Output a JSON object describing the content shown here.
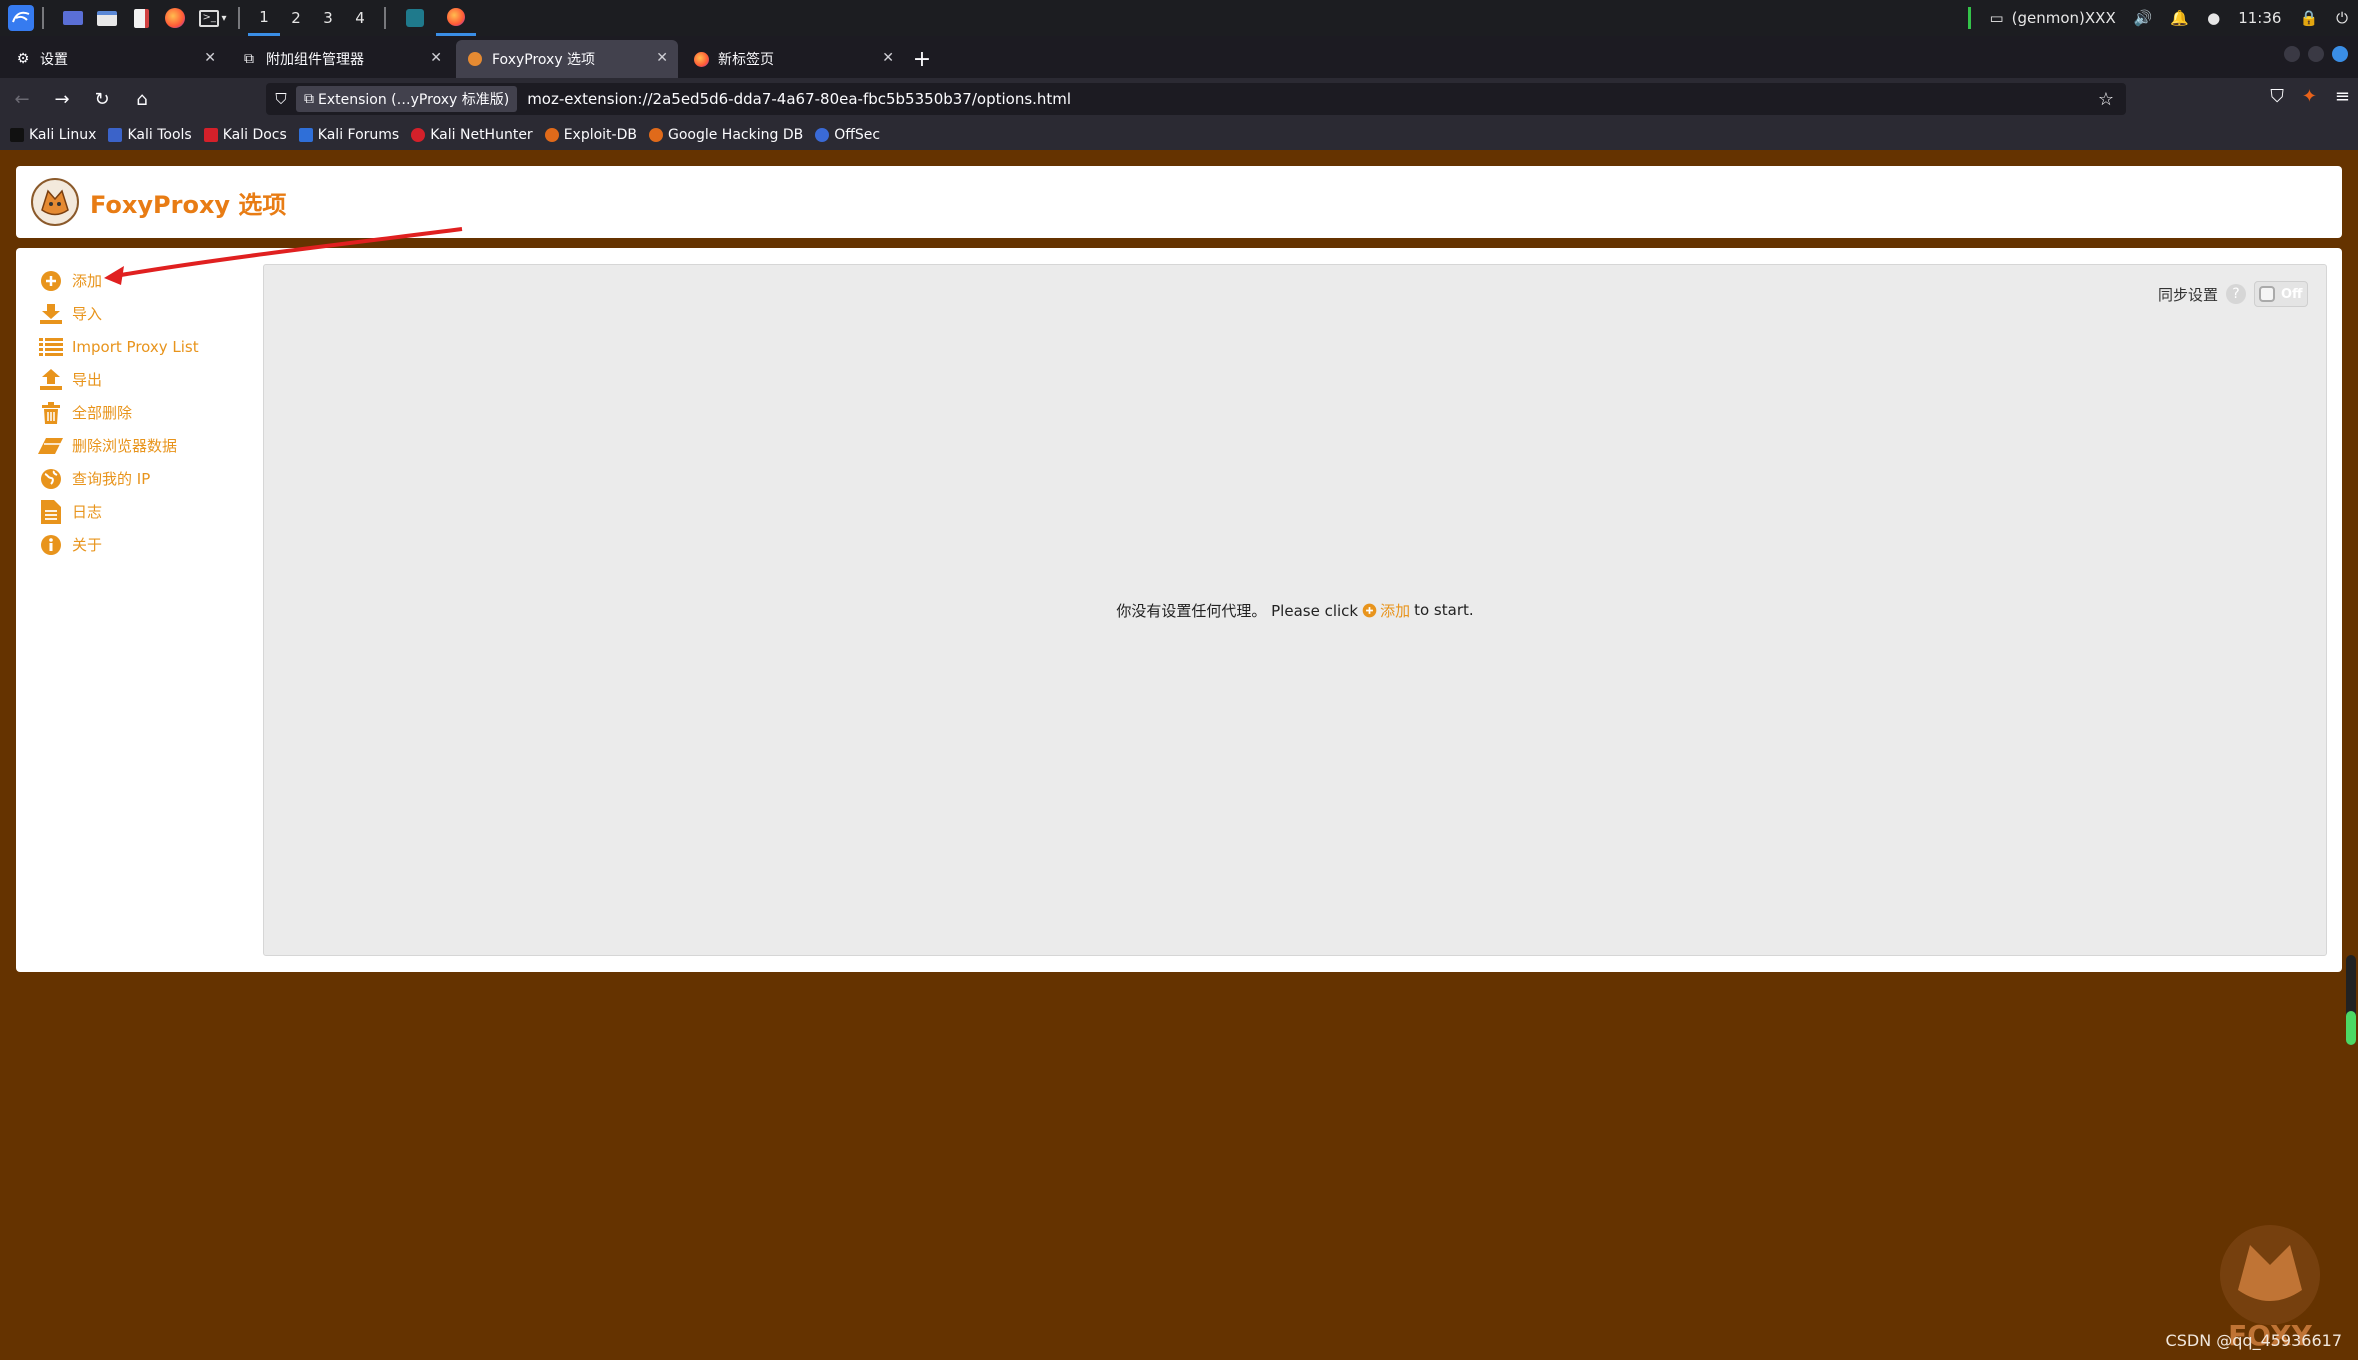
{
  "taskbar": {
    "workspaces": [
      "1",
      "2",
      "3",
      "4"
    ],
    "genmon": "(genmon)XXX",
    "clock": "11:36"
  },
  "tabs": [
    {
      "label": "设置",
      "icon": "gear-icon"
    },
    {
      "label": "附加组件管理器",
      "icon": "puzzle-icon"
    },
    {
      "label": "FoxyProxy 选项",
      "icon": "foxyproxy-icon",
      "active": true
    },
    {
      "label": "新标签页",
      "icon": "firefox-icon"
    }
  ],
  "urlbar": {
    "identity": "Extension (…yProxy 标准版)",
    "url": "moz-extension://2a5ed5d6-dda7-4a67-80ea-fbc5b5350b37/options.html"
  },
  "bookmarks": [
    {
      "label": "Kali Linux",
      "color": "#1a1a1a"
    },
    {
      "label": "Kali Tools",
      "color": "#3b63c9"
    },
    {
      "label": "Kali Docs",
      "color": "#d4202a"
    },
    {
      "label": "Kali Forums",
      "color": "#2f6fd8"
    },
    {
      "label": "Kali NetHunter",
      "color": "#d4202a"
    },
    {
      "label": "Exploit-DB",
      "color": "#e06a1a"
    },
    {
      "label": "Google Hacking DB",
      "color": "#e06a1a"
    },
    {
      "label": "OffSec",
      "color": "#3a6ad6"
    }
  ],
  "page": {
    "title": "FoxyProxy 选项",
    "sidebar": [
      {
        "label": "添加",
        "icon": "add-circle-icon"
      },
      {
        "label": "导入",
        "icon": "download-icon"
      },
      {
        "label": "Import Proxy List",
        "icon": "list-icon"
      },
      {
        "label": "导出",
        "icon": "upload-icon"
      },
      {
        "label": "全部删除",
        "icon": "trash-icon"
      },
      {
        "label": "删除浏览器数据",
        "icon": "eraser-icon"
      },
      {
        "label": "查询我的 IP",
        "icon": "globe-icon"
      },
      {
        "label": "日志",
        "icon": "document-icon"
      },
      {
        "label": "关于",
        "icon": "info-icon"
      }
    ],
    "sync": {
      "label": "同步设置",
      "help": "?",
      "toggle": "Off"
    },
    "empty": {
      "prefix": "你没有设置任何代理。 Please click",
      "link": "添加",
      "suffix": "to start."
    }
  },
  "watermark": "CSDN @qq_45936617",
  "colors": {
    "accent": "#e8941c",
    "title": "#e87c14",
    "background": "#653300"
  }
}
